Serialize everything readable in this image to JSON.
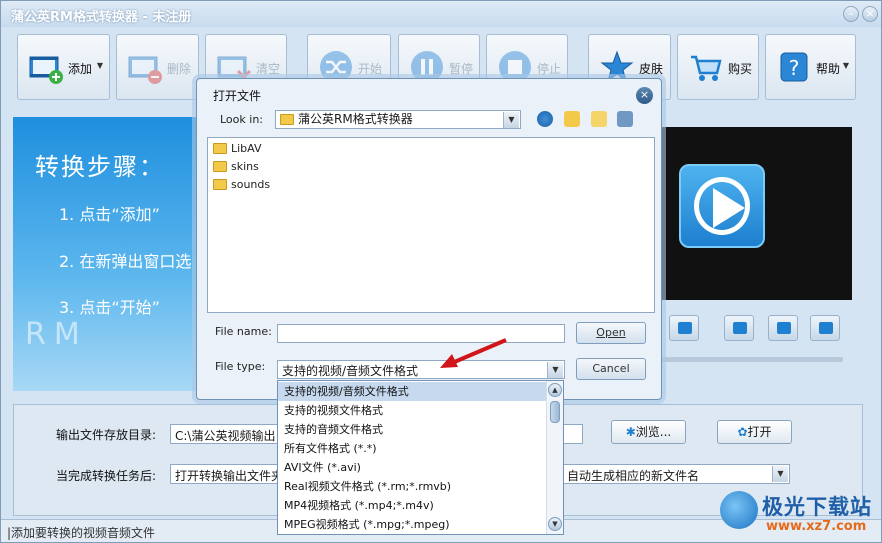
{
  "window": {
    "title": "蒲公英RM格式转换器 - 未注册",
    "minimize_glyph": "–",
    "close_glyph": "×"
  },
  "toolbar": {
    "add": "添加",
    "delete": "删除",
    "clear": "清空",
    "start": "开始",
    "pause": "暂停",
    "stop": "停止",
    "skin": "皮肤",
    "buy": "购买",
    "help": "帮助",
    "dropdown_glyph": "▼"
  },
  "steps": {
    "title": "转换步骤：",
    "step1": "1. 点击“添加”",
    "step2": "2. 在新弹出窗口选",
    "step3": "3. 点击“开始”",
    "watermark": "RM"
  },
  "output": {
    "dir_label": "输出文件存放目录:",
    "dir_value": "C:\\蒲公英视频输出",
    "browse": "浏览...",
    "open": "打开",
    "after_label": "当完成转换任务后:",
    "after_value": "打开转换输出文件夹",
    "naming_value": "自动生成相应的新文件名"
  },
  "status": {
    "text": "|添加要转换的视频音频文件"
  },
  "dialog": {
    "title": "打开文件",
    "close_glyph": "×",
    "look_in_label": "Look in:",
    "look_in_value": "蒲公英RM格式转换器",
    "files": [
      "LibAV",
      "skins",
      "sounds"
    ],
    "filename_label": "File name:",
    "filename_value": "",
    "filetype_label": "File type:",
    "filetype_value": "支持的视频/音频文件格式",
    "open_button": "Open",
    "cancel_button": "Cancel"
  },
  "dropdown": {
    "items": [
      "支持的视频/音频文件格式",
      "支持的视频文件格式",
      "支持的音频文件格式",
      "所有文件格式 (*.*)",
      "AVI文件 (*.avi)",
      "Real视频文件格式 (*.rm;*.rmvb)",
      "MP4视频格式 (*.mp4;*.m4v)",
      "MPEG视频格式 (*.mpg;*.mpeg)"
    ],
    "selected_index": 0,
    "scroll_up": "▲",
    "scroll_down": "▼"
  },
  "watermark": {
    "brand": "极光下载站",
    "url": "www.xz7.com"
  },
  "colors": {
    "accent": "#1f7fd0",
    "title_bg": "#c8dbee",
    "dialog_bg": "#eaf1f8",
    "selection": "#c6d9ee",
    "arrow": "#d0161b"
  }
}
